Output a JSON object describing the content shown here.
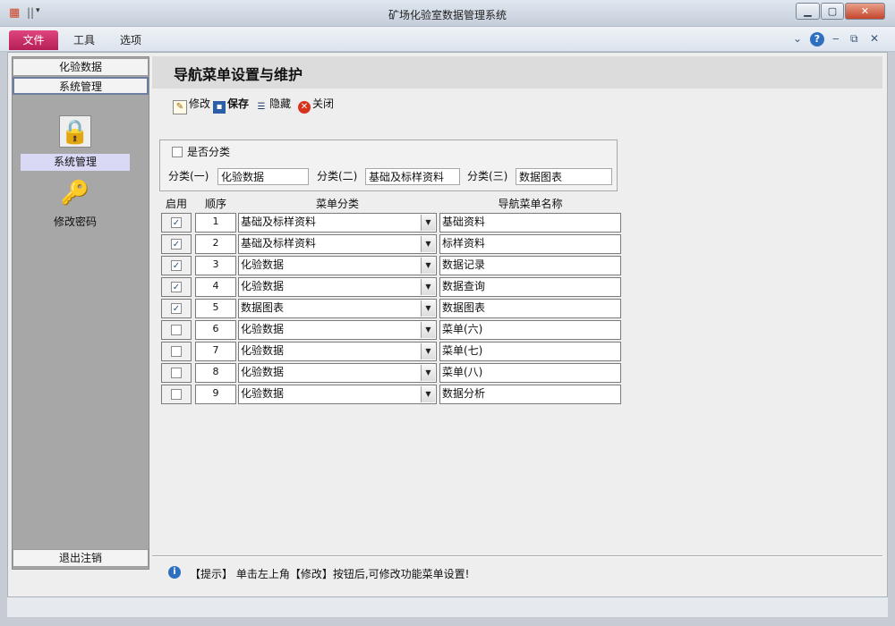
{
  "window": {
    "title": "矿场化验室数据管理系统"
  },
  "ribbon": {
    "tabs": [
      "文件",
      "工具",
      "选项"
    ]
  },
  "nav": {
    "section_top": "化验数据",
    "section_active": "系统管理",
    "items": [
      {
        "label": "系统管理",
        "icon": "lock-icon"
      },
      {
        "label": "修改密码",
        "icon": "key-icon"
      }
    ],
    "logout": "退出注销"
  },
  "page": {
    "title": "导航菜单设置与维护"
  },
  "toolbar": {
    "edit": "修改",
    "save": "保存",
    "hide": "隐藏",
    "close": "关闭"
  },
  "filter": {
    "classify_label": "是否分类",
    "classify_checked": false,
    "cat1_label": "分类(一)",
    "cat1_value": "化验数据",
    "cat2_label": "分类(二)",
    "cat2_value": "基础及标样资料",
    "cat3_label": "分类(三)",
    "cat3_value": "数据图表"
  },
  "grid": {
    "headers": {
      "enabled": "启用",
      "order": "顺序",
      "category": "菜单分类",
      "name": "导航菜单名称"
    },
    "rows": [
      {
        "enabled": true,
        "order": "1",
        "category": "基础及标样资料",
        "name": "基础资料"
      },
      {
        "enabled": true,
        "order": "2",
        "category": "基础及标样资料",
        "name": "标样资料"
      },
      {
        "enabled": true,
        "order": "3",
        "category": "化验数据",
        "name": "数据记录"
      },
      {
        "enabled": true,
        "order": "4",
        "category": "化验数据",
        "name": "数据查询"
      },
      {
        "enabled": true,
        "order": "5",
        "category": "数据图表",
        "name": "数据图表"
      },
      {
        "enabled": false,
        "order": "6",
        "category": "化验数据",
        "name": "菜单(六)"
      },
      {
        "enabled": false,
        "order": "7",
        "category": "化验数据",
        "name": "菜单(七)"
      },
      {
        "enabled": false,
        "order": "8",
        "category": "化验数据",
        "name": "菜单(八)"
      },
      {
        "enabled": false,
        "order": "9",
        "category": "化验数据",
        "name": "数据分析"
      }
    ]
  },
  "status": {
    "hint": "【提示】 单击左上角【修改】按钮后,可修改功能菜单设置!"
  }
}
